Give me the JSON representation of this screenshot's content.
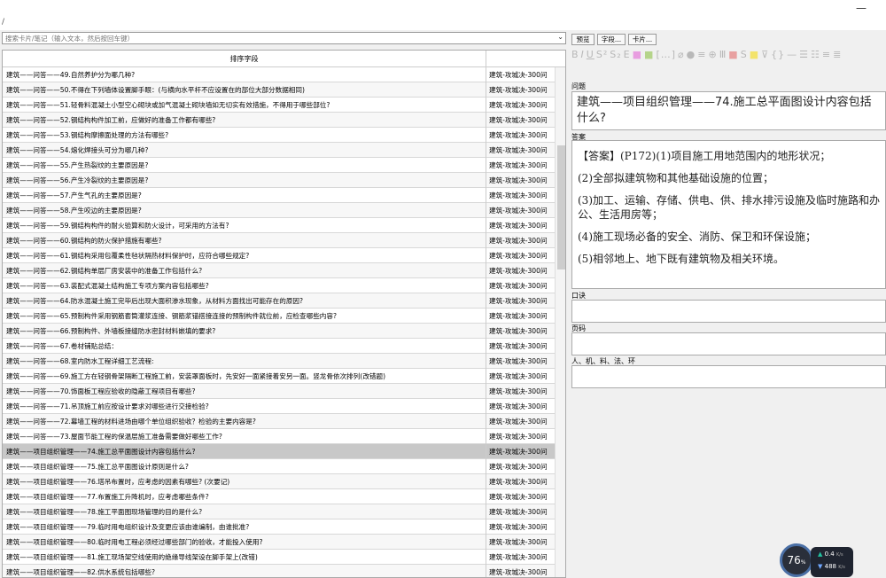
{
  "window": {
    "corner_mark": "/",
    "minimize": "—"
  },
  "search": {
    "placeholder": "搜索卡片/笔记（输入文本，然后按回车键）",
    "dropdown": "⌄"
  },
  "table": {
    "col1_header": "排序字段",
    "col2_header": "",
    "rows": [
      {
        "q": "建筑——问答——49.自然养护分为哪几种?",
        "deck": "建筑-攻城决-300问"
      },
      {
        "q": "建筑——问答——50.不得在下列墙体设置脚手眼：(与横向水平杆不应设置在的部位大部分数据相同)",
        "deck": "建筑-攻城决-300问"
      },
      {
        "q": "建筑——问答——51.轻骨料混凝土小型空心砌块或加气混凝土砌块墙如无切实有效措施，不得用于哪些部位?",
        "deck": "建筑-攻城决-300问"
      },
      {
        "q": "建筑——问答——52.钢结构构件加工前，应做好的准备工作都有哪些?",
        "deck": "建筑-攻城决-300问"
      },
      {
        "q": "建筑——问答——53.钢结构摩擦面处理的方法有哪些?",
        "deck": "建筑-攻城决-300问"
      },
      {
        "q": "建筑——问答——54.熔化焊接头可分为哪几种?",
        "deck": "建筑-攻城决-300问"
      },
      {
        "q": "建筑——问答——55.产生热裂纹的主要原因是?",
        "deck": "建筑-攻城决-300问"
      },
      {
        "q": "建筑——问答——56.产生冷裂纹的主要原因是?",
        "deck": "建筑-攻城决-300问"
      },
      {
        "q": "建筑——问答——57.产生气孔的主要原因是?",
        "deck": "建筑-攻城决-300问"
      },
      {
        "q": "建筑——问答——58.产生咬边的主要原因是?",
        "deck": "建筑-攻城决-300问"
      },
      {
        "q": "建筑——问答——59.钢结构构件的耐火验算和防火设计，可采用的方法有?",
        "deck": "建筑-攻城决-300问"
      },
      {
        "q": "建筑——问答——60.钢结构的防火保护措施有哪些?",
        "deck": "建筑-攻城决-300问"
      },
      {
        "q": "建筑——问答——61.钢结构采用包覆柔性毡状隔热材料保护时，应符合哪些规定?",
        "deck": "建筑-攻城决-300问"
      },
      {
        "q": "建筑——问答——62.钢结构单层厂房安装中的准备工作包括什么?",
        "deck": "建筑-攻城决-300问"
      },
      {
        "q": "建筑——问答——63.装配式混凝土结构施工专项方案内容包括哪些?",
        "deck": "建筑-攻城决-300问"
      },
      {
        "q": "建筑——问答——64.防水混凝土施工完毕后出现大面积渗水现象，从材料方面找出可能存在的原因?",
        "deck": "建筑-攻城决-300问"
      },
      {
        "q": "建筑——问答——65.预制构件采用钢筋套筒灌浆连接、钢筋浆锚搭接连接的预制构件就位前，应检查哪些内容?",
        "deck": "建筑-攻城决-300问"
      },
      {
        "q": "建筑——问答——66.预制构件、外墙板接缝防水密封材料嵌填的要求?",
        "deck": "建筑-攻城决-300问"
      },
      {
        "q": "建筑——问答——67.卷材铺贴总结：",
        "deck": "建筑-攻城决-300问"
      },
      {
        "q": "建筑——问答——68.室内防水工程详细工艺流程:",
        "deck": "建筑-攻城决-300问"
      },
      {
        "q": "建筑——问答——69.施工方在轻钢骨架隔断工程施工前，安装罩面板时，先安好一面紧接着安另一面。竖龙骨依次排列(改错题)",
        "deck": "建筑-攻城决-300问"
      },
      {
        "q": "建筑——问答——70.饰面板工程应验收的隐蔽工程项目有哪些?",
        "deck": "建筑-攻城决-300问"
      },
      {
        "q": "建筑——问答——71.吊顶施工前应按设计要求对哪些进行交接检验?",
        "deck": "建筑-攻城决-300问"
      },
      {
        "q": "建筑——问答——72.幕墙工程的材料进场由哪个单位组织验收？检验的主要内容是?",
        "deck": "建筑-攻城决-300问"
      },
      {
        "q": "建筑——问答——73.屋面节能工程的保温层施工准备需要做好哪些工作?",
        "deck": "建筑-攻城决-300问"
      },
      {
        "q": "建筑——项目组织管理——74.施工总平面图设计内容包括什么?",
        "deck": "建筑-攻城决-300问"
      },
      {
        "q": "建筑——项目组织管理——75.施工总平面图设计原则是什么?",
        "deck": "建筑-攻城决-300问"
      },
      {
        "q": "建筑——项目组织管理——76.塔吊布置时，应考虑的因素有哪些? (次要记)",
        "deck": "建筑-攻城决-300问"
      },
      {
        "q": "建筑——项目组织管理——77.布置施工升降机时，应考虑哪些条件?",
        "deck": "建筑-攻城决-300问"
      },
      {
        "q": "建筑——项目组织管理——78.施工平面图现场管理的目的是什么?",
        "deck": "建筑-攻城决-300问"
      },
      {
        "q": "建筑——项目组织管理——79.临时用电组织设计及变更应该由谁编制，由谁批准?",
        "deck": "建筑-攻城决-300问"
      },
      {
        "q": "建筑——项目组织管理——80.临时用电工程必须经过哪些部门的验收，才能投入使用?",
        "deck": "建筑-攻城决-300问"
      },
      {
        "q": "建筑——项目组织管理——81.施工现场架空线使用的绝缘导线架设在脚手架上(改错)",
        "deck": "建筑-攻城决-300问"
      },
      {
        "q": "建筑——项目组织管理——82.供水系统包括哪些?",
        "deck": "建筑-攻城决-300问"
      }
    ],
    "selected_index": 25
  },
  "editor": {
    "buttons": [
      "预览",
      "字段...",
      "卡片..."
    ],
    "fields": {
      "question_label": "问题",
      "question": "建筑——项目组织管理——74.施工总平面图设计内容包括什么?",
      "answer_label": "答案",
      "answer": [
        "【答案】(P172)(1)项目施工用地范围内的地形状况；",
        "(2)全部拟建筑物和其他基础设施的位置；",
        "(3)加工、运输、存储、供电、供、排水排污设施及临时施路和办公、生活用房等；",
        "(4)施工现场必备的安全、消防、保卫和环保设施；",
        "(5)相邻地上、地下既有建筑物及相关环境。"
      ],
      "mnemonic_label": "口诀",
      "mnemonic": "",
      "page_label": "页码",
      "page": "",
      "factors_label": "人、机、料、法、环",
      "factors": ""
    }
  },
  "widget": {
    "percent": "76",
    "percent_unit": "%",
    "up": "0.4",
    "up_unit": "K/s",
    "down": "488",
    "down_unit": "K/s"
  }
}
